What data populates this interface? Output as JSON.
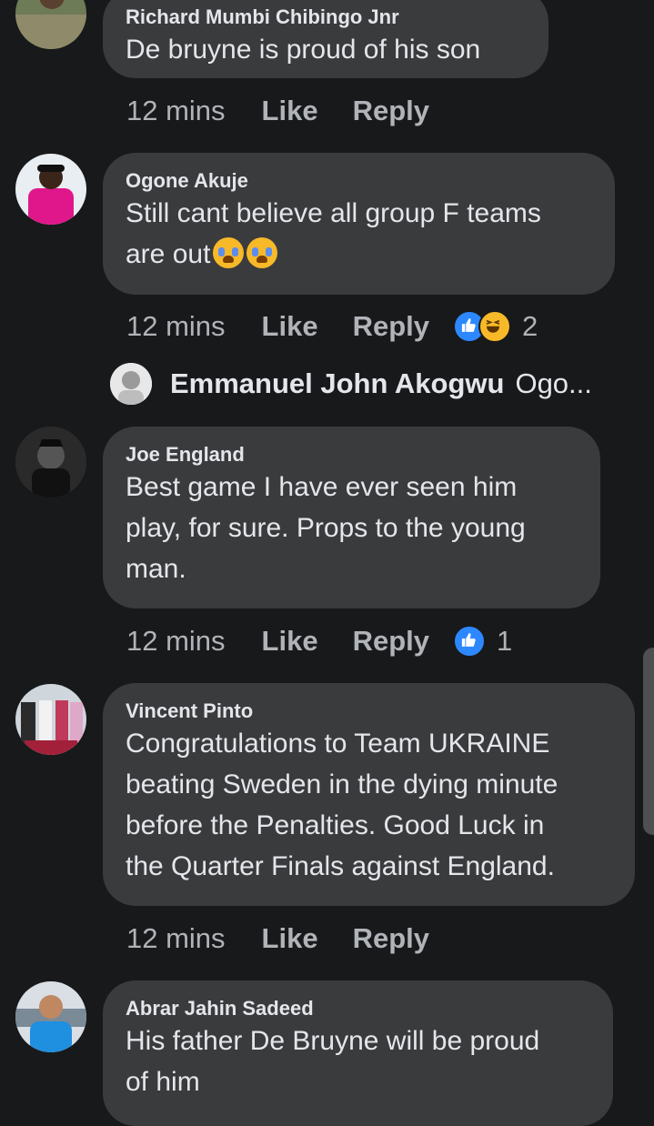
{
  "comments": [
    {
      "author": "Richard Mumbi Chibingo Jnr",
      "text": [
        "De bruyne is proud of his son"
      ],
      "time": "12 mins",
      "like": "Like",
      "reply": "Reply"
    },
    {
      "author": "Ogone Akuje",
      "text": [
        "Still cant believe all group F teams",
        "are out"
      ],
      "time": "12 mins",
      "like": "Like",
      "reply": "Reply",
      "reactions": {
        "icons": [
          "like-icon",
          "laugh-icon"
        ],
        "count": "2"
      },
      "reply_preview": {
        "name": "Emmanuel John Akogwu",
        "snippet": "Ogo..."
      }
    },
    {
      "author": "Joe England",
      "text": [
        "Best game I have ever seen him",
        "play, for sure. Props to the young",
        "man."
      ],
      "time": "12 mins",
      "like": "Like",
      "reply": "Reply",
      "reactions": {
        "icons": [
          "like-icon"
        ],
        "count": "1"
      }
    },
    {
      "author": "Vincent Pinto",
      "text": [
        "Congratulations to Team UKRAINE",
        "beating Sweden in the dying minute",
        "before the Penalties. Good Luck in",
        "the Quarter Finals against England."
      ],
      "time": "12 mins",
      "like": "Like",
      "reply": "Reply"
    },
    {
      "author": "Abrar Jahin Sadeed",
      "text": [
        "His father De Bruyne will be proud",
        "of him"
      ]
    }
  ],
  "colors": {
    "background": "#18191a",
    "bubble": "#3a3b3c",
    "secondary_text": "#b0b3b8",
    "like_blue": "#2d88ff",
    "haha_yellow": "#f7b928"
  }
}
